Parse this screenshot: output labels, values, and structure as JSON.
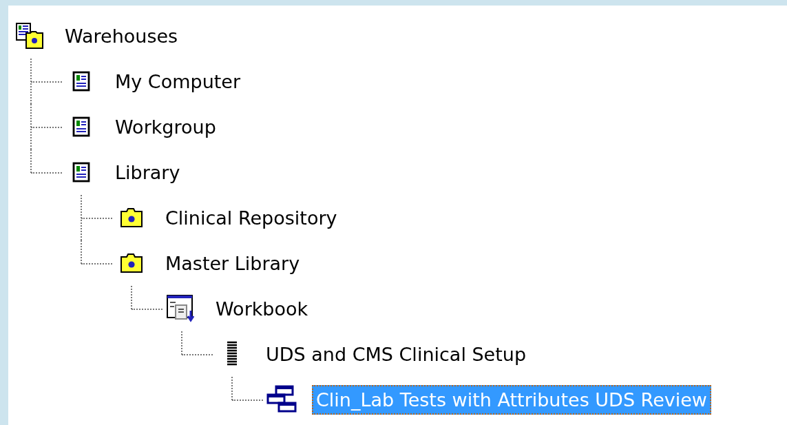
{
  "tree": [
    {
      "label": "Warehouses",
      "kind": "warehouses",
      "selected": false,
      "children": [
        {
          "label": "My Computer",
          "kind": "server",
          "selected": false
        },
        {
          "label": "Workgroup",
          "kind": "server",
          "selected": false
        },
        {
          "label": "Library",
          "kind": "server",
          "selected": false,
          "children": [
            {
              "label": "Clinical Repository",
              "kind": "folder",
              "selected": false
            },
            {
              "label": "Master Library",
              "kind": "folder",
              "selected": false,
              "children": [
                {
                  "label": "Workbook",
                  "kind": "workbook",
                  "selected": false,
                  "children": [
                    {
                      "label": "UDS and CMS Clinical Setup",
                      "kind": "list",
                      "selected": false,
                      "children": [
                        {
                          "label": "Clin_Lab Tests with Attributes UDS Review",
                          "kind": "worksheet",
                          "selected": true
                        }
                      ]
                    }
                  ]
                }
              ]
            }
          ]
        }
      ]
    }
  ]
}
